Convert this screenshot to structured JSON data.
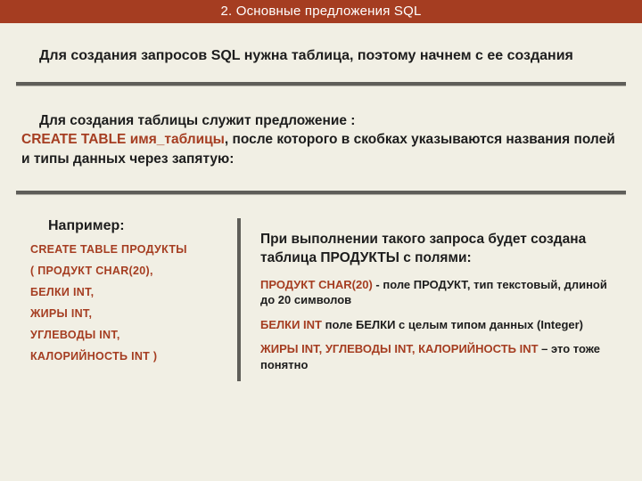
{
  "header": {
    "title": "2. Основные предложения SQL"
  },
  "intro": {
    "text": "Для создания запросов SQL нужна таблица, поэтому начнем с ее создания"
  },
  "para2": {
    "lead": "Для создания таблицы служит предложение :",
    "cmd": "CREATE TABLE имя_таблицы",
    "tail": ", после которого в скобках указываются названия полей и типы данных через запятую:"
  },
  "example": {
    "title": "Например:",
    "lines": [
      "CREATE  TABLE  ПРОДУКТЫ",
      "( ПРОДУКТ CHAR(20),",
      "БЕЛКИ  INT,",
      "ЖИРЫ INT,",
      "УГЛЕВОДЫ INT,",
      "КАЛОРИЙНОСТЬ INT )"
    ]
  },
  "right": {
    "intro": "При выполнении такого запроса будет создана таблица ПРОДУКТЫ с полями:",
    "fields": [
      {
        "kw": "ПРОДУКТ CHAR(20)",
        "sep": " - ",
        "desc": "поле ПРОДУКТ, тип текстовый, длиной до 20 символов"
      },
      {
        "kw": "БЕЛКИ  INT",
        "sep": "  ",
        "desc": "поле БЕЛКИ с целым типом данных (Integer)"
      },
      {
        "kw": "ЖИРЫ INT, УГЛЕВОДЫ INT, КАЛОРИЙНОСТЬ INT",
        "sep": " – ",
        "desc": "это тоже понятно"
      }
    ]
  }
}
